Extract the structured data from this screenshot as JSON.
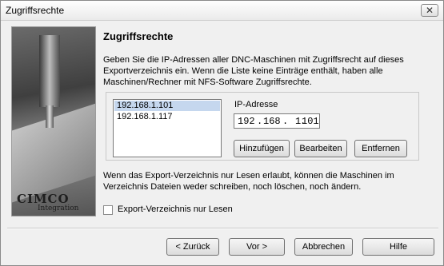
{
  "window": {
    "title": "Zugriffsrechte",
    "close_symbol": "✕"
  },
  "artwork": {
    "logo_main": "CIMCO",
    "logo_sub": "Integration"
  },
  "page": {
    "heading": "Zugriffsrechte",
    "description_lines": [
      "Geben Sie die IP-Adressen aller DNC-Maschinen mit Zugriffsrecht auf dieses",
      "Exportverzeichnis ein. Wenn die Liste keine Einträge enthält, haben alle",
      "Maschinen/Rechner mit NFS-Software Zugriffsrechte."
    ]
  },
  "ip_list": {
    "items": [
      "192.168.1.101",
      "192.168.1.117"
    ],
    "selected_index": 0
  },
  "ip_editor": {
    "label": "IP-Adresse",
    "octets": [
      "192",
      "168",
      "1",
      "101"
    ],
    "separator": "."
  },
  "list_buttons": {
    "add": "Hinzufügen",
    "edit": "Bearbeiten",
    "remove": "Entfernen"
  },
  "note_lines": [
    "Wenn das Export-Verzeichnis nur Lesen erlaubt, können die Maschinen im",
    "Verzeichnis Dateien weder schreiben, noch löschen, noch ändern."
  ],
  "readonly_option": {
    "label": "Export-Verzeichnis nur Lesen",
    "checked": false
  },
  "footer": {
    "back": "< Zurück",
    "next": "Vor >",
    "cancel": "Abbrechen",
    "help": "Hilfe"
  }
}
